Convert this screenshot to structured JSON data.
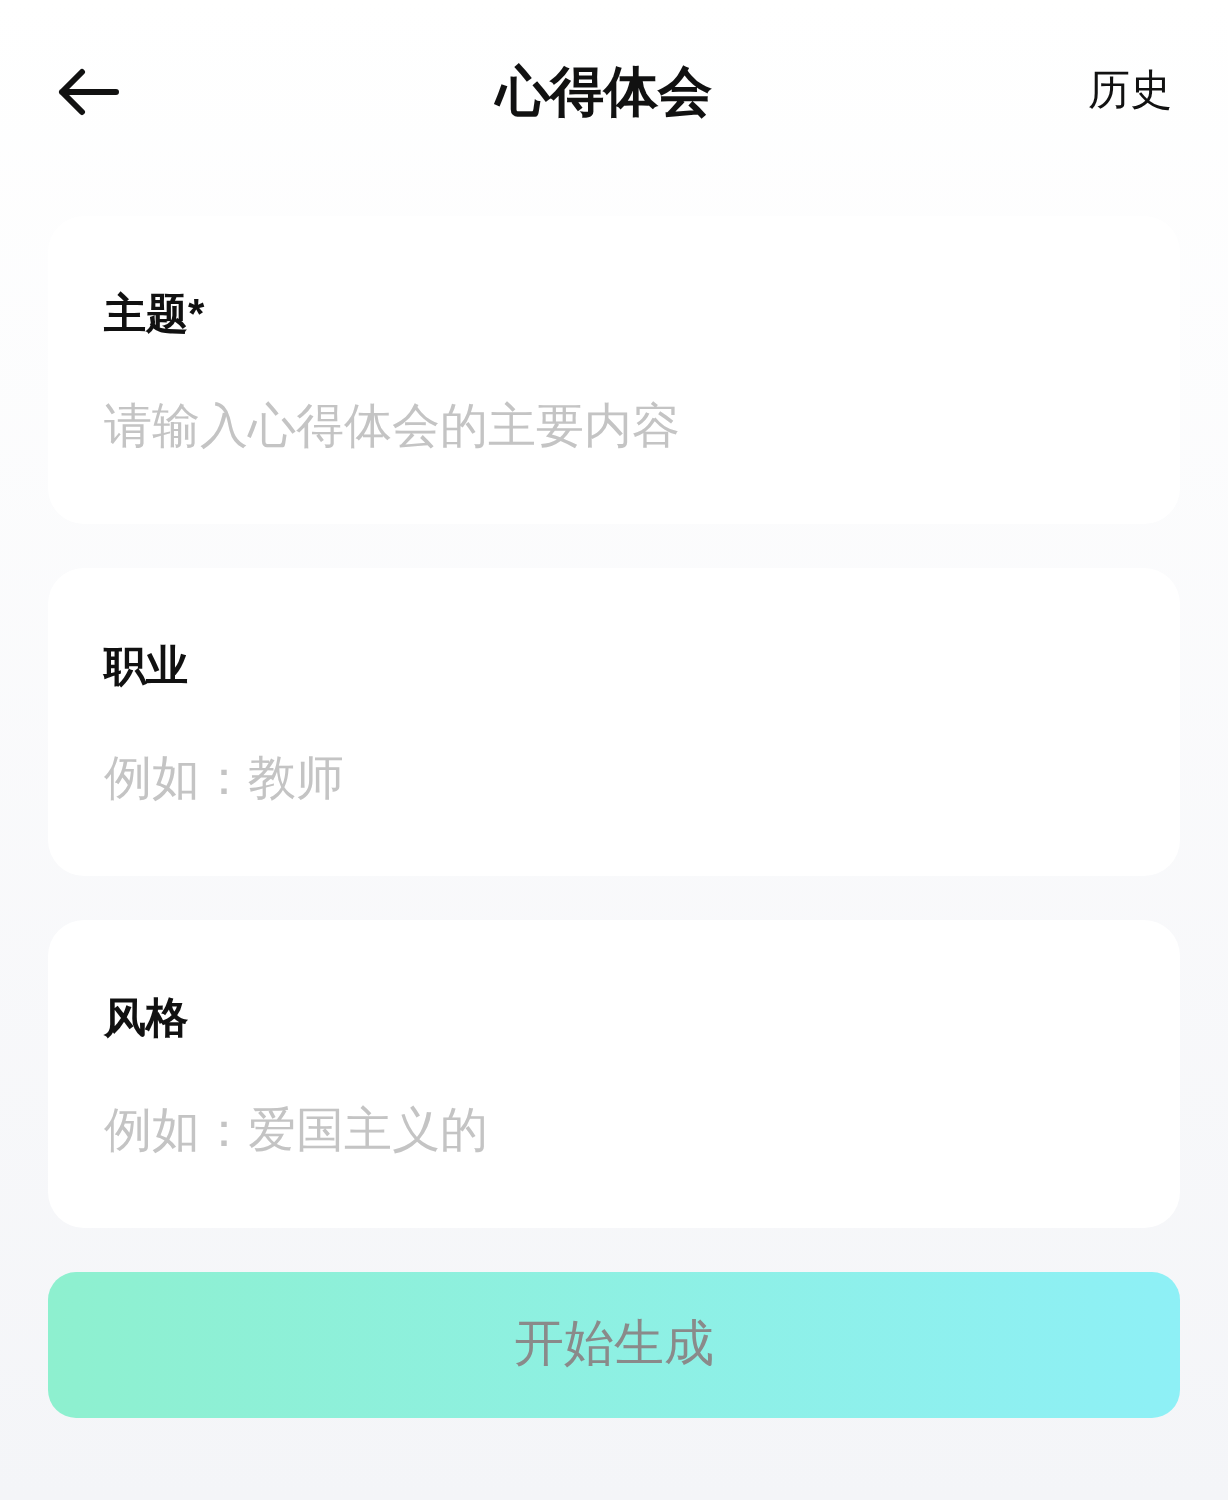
{
  "header": {
    "title": "心得体会",
    "action": "历史"
  },
  "fields": [
    {
      "label": "主题*",
      "placeholder": "请输入心得体会的主要内容"
    },
    {
      "label": "职业",
      "placeholder": "例如：教师"
    },
    {
      "label": "风格",
      "placeholder": "例如：爱国主义的"
    }
  ],
  "submit": {
    "label": "开始生成",
    "disabled": true
  }
}
